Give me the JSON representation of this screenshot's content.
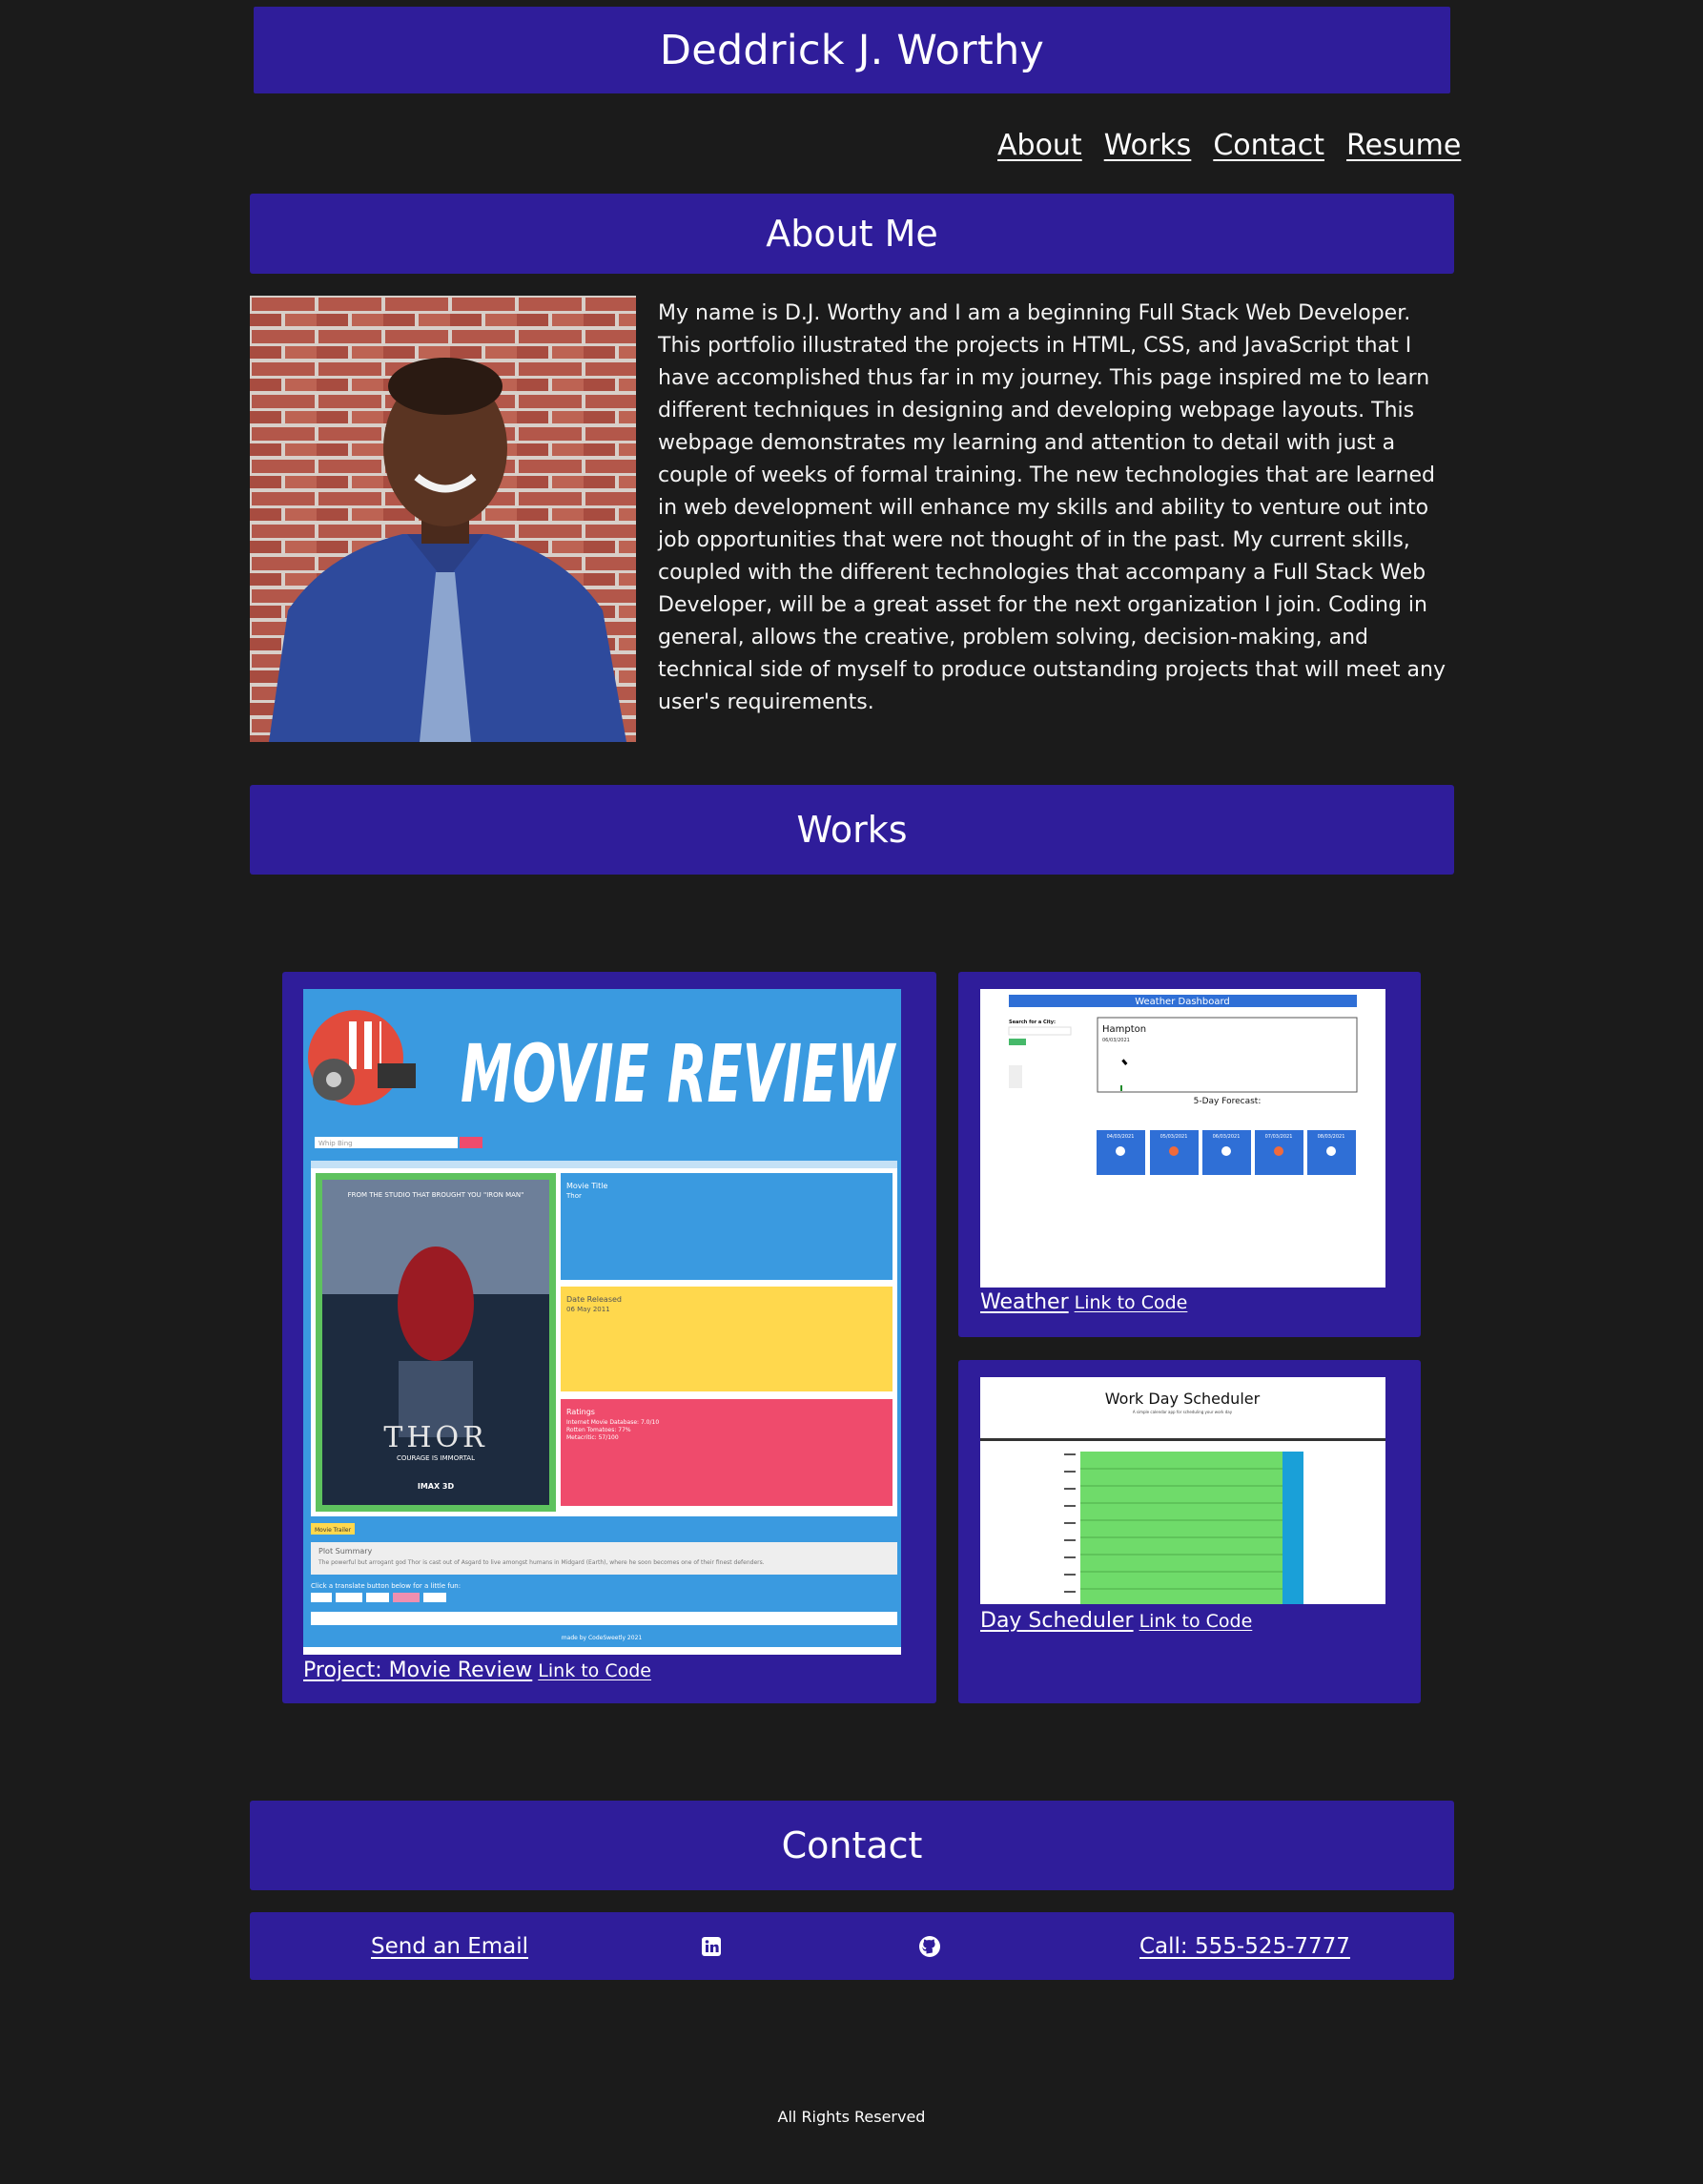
{
  "header": {
    "title": "Deddrick J. Worthy"
  },
  "nav": {
    "items": [
      {
        "label": "About"
      },
      {
        "label": "Works"
      },
      {
        "label": "Contact"
      },
      {
        "label": "Resume"
      }
    ]
  },
  "about": {
    "heading": "About Me",
    "paragraph": "My name is D.J. Worthy and I am a beginning Full Stack Web Developer. This portfolio illustrated the projects in HTML, CSS, and JavaScript that I have accomplished thus far in my journey. This page inspired me to learn different techniques in designing and developing webpage layouts. This webpage demonstrates my learning and attention to detail with just a couple of weeks of formal training. The new technologies that are learned in web development will enhance my skills and ability to venture out into job opportunities that were not thought of in the past. My current skills, coupled with the different technologies that accompany a Full Stack Web Developer, will be a great asset for the next organization I join. Coding in general, allows the creative, problem solving, decision-making, and technical side of myself to produce outstanding projects that will meet any user's requirements."
  },
  "works": {
    "heading": "Works",
    "projects": [
      {
        "title": "Project: Movie Review",
        "code_link": "Link to Code",
        "screenshot": {
          "banner": "MOVIE REVIEW",
          "search_placeholder": "Whip Bing",
          "poster_title": "THOR",
          "poster_tagline": "COURAGE IS IMMORTAL",
          "poster_top": "FROM THE STUDIO THAT BROUGHT YOU \"IRON MAN\"",
          "poster_format": "IMAX 3D",
          "panel1_label": "Movie Title",
          "panel1_value": "Thor",
          "panel2_label": "Date Released",
          "panel2_value": "06 May 2011",
          "panel3_label": "Ratings",
          "panel3_lines": [
            "Internet Movie Database: 7.0/10",
            "Rotten Tomatoes: 77%",
            "Metacritic: 57/100"
          ],
          "trailer_label": "Movie Trailer",
          "plot_label": "Plot Summary",
          "plot_text": "The powerful but arrogant god Thor is cast out of Asgard to live amongst humans in Midgard (Earth), where he soon becomes one of their finest defenders.",
          "translate_prompt": "Click a translate button below for a little fun:",
          "footer": "made by CodeSweetly 2021"
        },
        "colors": {
          "blue": "#3a9ae0",
          "yellow": "#ffd84d",
          "pink": "#ef4b6c",
          "green": "#5ec25e"
        }
      },
      {
        "title": "Weather",
        "code_link": "Link to Code",
        "screenshot": {
          "header": "Weather Dashboard",
          "search_label": "Search for a City:",
          "city": "Hampton",
          "date": "06/03/2021",
          "forecast_label": "5-Day Forecast:",
          "forecast_dates": [
            "04/03/2021",
            "05/03/2021",
            "06/03/2021",
            "07/03/2021",
            "08/03/2021"
          ]
        }
      },
      {
        "title": "Day Scheduler",
        "code_link": "Link to Code",
        "screenshot": {
          "header": "Work Day Scheduler",
          "subheader": "A simple calendar app for scheduling your work day"
        }
      }
    ]
  },
  "contact": {
    "heading": "Contact",
    "email_label": "Send an Email",
    "linkedin_icon": "linkedin-icon",
    "github_icon": "github-icon",
    "phone_label": "Call: 555-525-7777"
  },
  "footer": {
    "text": "All Rights Reserved"
  }
}
